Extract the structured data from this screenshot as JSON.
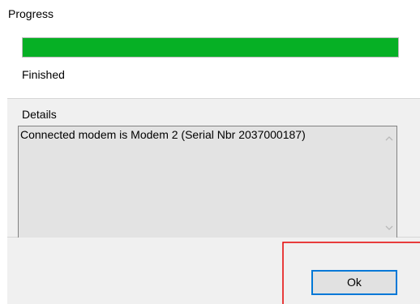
{
  "window": {
    "title": "Progress"
  },
  "progress": {
    "fraction_complete": 1,
    "fill_color": "#06b025",
    "status_text": "Finished"
  },
  "details": {
    "label": "Details",
    "text": "Connected modem is Modem 2 (Serial Nbr 2037000187)"
  },
  "buttons": {
    "ok_label": "Ok"
  },
  "icons": {
    "scroll_up": "chevron-up-icon",
    "scroll_down": "chevron-down-icon"
  },
  "colors": {
    "focus_border": "#0078d7",
    "annotation_border": "#e60000"
  }
}
